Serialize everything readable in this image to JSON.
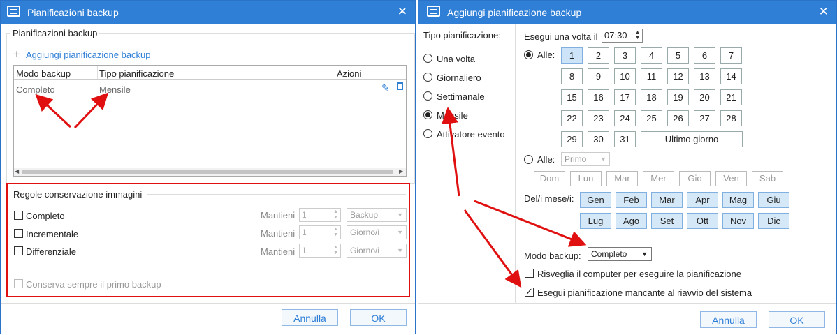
{
  "left": {
    "title": "Pianificazioni backup",
    "group_label": "Pianificazioni backup",
    "add_link": "Aggiungi pianificazione backup",
    "columns": [
      "Modo backup",
      "Tipo pianificazione",
      "Azioni"
    ],
    "rows": [
      {
        "mode": "Completo",
        "type": "Mensile"
      }
    ],
    "retention": {
      "label": "Regole conservazione immagini",
      "items": [
        {
          "name": "Completo",
          "keep_label": "Mantieni",
          "value": "1",
          "unit": "Backup"
        },
        {
          "name": "Incrementale",
          "keep_label": "Mantieni",
          "value": "1",
          "unit": "Giorno/i"
        },
        {
          "name": "Differenziale",
          "keep_label": "Mantieni",
          "value": "1",
          "unit": "Giorno/i"
        }
      ],
      "keep_first": "Conserva sempre il primo backup"
    },
    "cancel": "Annulla",
    "ok": "OK"
  },
  "right": {
    "title": "Aggiungi pianificazione backup",
    "type_label": "Tipo pianificazione:",
    "types": [
      {
        "label": "Una volta",
        "selected": false
      },
      {
        "label": "Giornaliero",
        "selected": false
      },
      {
        "label": "Settimanale",
        "selected": false
      },
      {
        "label": "Mensile",
        "selected": true
      },
      {
        "label": "Attivatore evento",
        "selected": false
      }
    ],
    "run_once_label": "Esegui una volta il",
    "time": "07:30",
    "at_label": "Alle:",
    "days": [
      "1",
      "2",
      "3",
      "4",
      "5",
      "6",
      "7",
      "8",
      "9",
      "10",
      "11",
      "12",
      "13",
      "14",
      "15",
      "16",
      "17",
      "18",
      "19",
      "20",
      "21",
      "22",
      "23",
      "24",
      "25",
      "26",
      "27",
      "28",
      "29",
      "30",
      "31"
    ],
    "last_day": "Ultimo giorno",
    "at2_label": "Alle:",
    "ordinal": "Primo",
    "weekdays": [
      "Dom",
      "Lun",
      "Mar",
      "Mer",
      "Gio",
      "Ven",
      "Sab"
    ],
    "months_label": "Del/i mese/i:",
    "months": [
      "Gen",
      "Feb",
      "Mar",
      "Apr",
      "Mag",
      "Giu",
      "Lug",
      "Ago",
      "Set",
      "Ott",
      "Nov",
      "Dic"
    ],
    "mode_label": "Modo backup:",
    "mode_value": "Completo",
    "wake_label": "Risveglia il computer per eseguire la pianificazione",
    "wake_checked": false,
    "missed_label": "Esegui pianificazione mancante al riavvio del sistema",
    "missed_checked": true,
    "cancel": "Annulla",
    "ok": "OK"
  },
  "colors": {
    "titlebar": "#2f7fd6",
    "highlight_box": "#e01010",
    "arrow": "#e01010",
    "month_selected": "#d4e8f8"
  },
  "icons": [
    "edit-icon",
    "trash-icon",
    "close-icon",
    "window-icon",
    "plus-icon"
  ]
}
